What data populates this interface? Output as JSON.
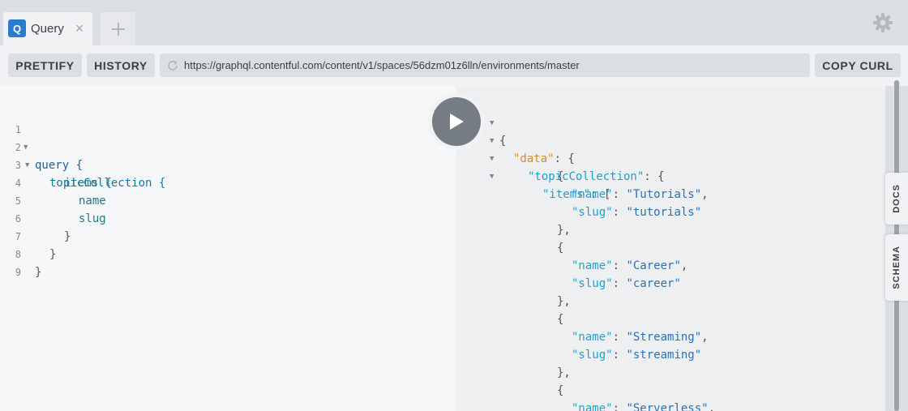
{
  "tabs": {
    "active": {
      "badge": "Q",
      "title": "Query",
      "close": "×"
    }
  },
  "toolbar": {
    "prettify_label": "PRETTIFY",
    "history_label": "HISTORY",
    "url": "https://graphql.contentful.com/content/v1/spaces/56dzm01z6lln/environments/master",
    "copy_curl_label": "COPY CURL"
  },
  "query_lines": [
    {
      "n": "1",
      "text": "query {"
    },
    {
      "n": "2",
      "text": "topicCollection {"
    },
    {
      "n": "3",
      "text": "items {"
    },
    {
      "n": "4",
      "text": "name"
    },
    {
      "n": "5",
      "text": "slug"
    },
    {
      "n": "6",
      "text": "}"
    },
    {
      "n": "7",
      "text": "}"
    },
    {
      "n": "8",
      "text": "}"
    },
    {
      "n": "9",
      "text": ""
    }
  ],
  "result": {
    "open_brace": "{",
    "data_key": "\"data\"",
    "collection_key": "\"topicCollection\"",
    "items_key": "\"items\"",
    "items": [
      {
        "name": "\"Tutorials\"",
        "slug": "\"tutorials\""
      },
      {
        "name": "\"Career\"",
        "slug": "\"career\""
      },
      {
        "name": "\"Streaming\"",
        "slug": "\"streaming\""
      },
      {
        "name": "\"Serverless\""
      }
    ],
    "name_key": "\"name\"",
    "slug_key": "\"slug\""
  },
  "side_tabs": {
    "docs": "DOCS",
    "schema": "SCHEMA"
  },
  "colors": {
    "badge": "#2a7bd0",
    "data_key": "#d98b26",
    "key": "#1f9fd0",
    "string": "#2a72b5"
  },
  "icons": [
    "close-icon",
    "plus-icon",
    "gear-icon",
    "refresh-icon",
    "play-icon"
  ]
}
